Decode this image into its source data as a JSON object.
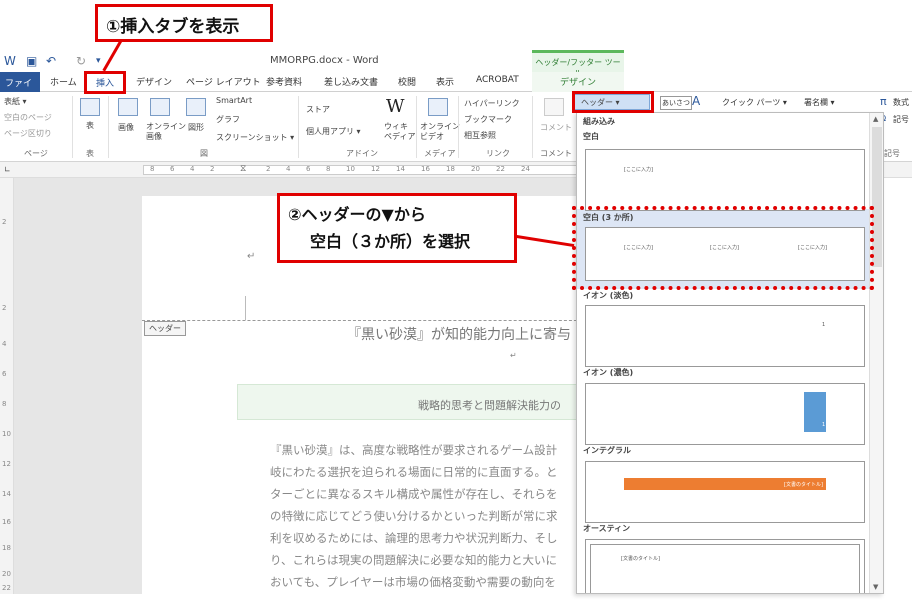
{
  "window": {
    "doc_title": "MMORPG.docx - Word",
    "context_group": "ヘッダー/フッター ツール",
    "context_tab": "デザイン"
  },
  "tabs": {
    "file": "ファイル",
    "home": "ホーム",
    "insert": "挿入",
    "design": "デザイン",
    "page_layout": "ページ レイアウト",
    "references": "参考資料",
    "mailings": "差し込み文書",
    "review": "校閲",
    "view": "表示",
    "acrobat": "ACROBAT"
  },
  "ribbon": {
    "pages": {
      "cover": "表紙 ▾",
      "blank": "空白のページ",
      "break": "ページ区切り",
      "label": "ページ"
    },
    "tables": {
      "table": "表",
      "label": "表"
    },
    "illustrations": {
      "picture": "画像",
      "online_picture": "オンライン\n画像",
      "shapes": "図形",
      "smartart": "SmartArt",
      "chart": "グラフ",
      "screenshot": "スクリーンショット ▾",
      "label": "図"
    },
    "addins": {
      "store": "ストア",
      "my_apps": "個人用アプリ ▾",
      "wikipedia": "ウィキ\nペディア",
      "label": "アドイン"
    },
    "media": {
      "online_video": "オンライン\nビデオ",
      "label": "メディア"
    },
    "links": {
      "hyperlink": "ハイパーリンク",
      "bookmark": "ブックマーク",
      "crossref": "相互参照",
      "label": "リンク"
    },
    "comments": {
      "comment": "コメント",
      "label": "コメント"
    },
    "header_button": "ヘッダー ▾",
    "quick_parts": "クイック パーツ ▾",
    "signature": "署名欄 ▾",
    "equation": "数式",
    "symbol": "記号",
    "symbols_label": "記号",
    "textbox_label": "あいさつ"
  },
  "ruler": [
    "8",
    "6",
    "4",
    "2",
    "2",
    "4",
    "6",
    "8",
    "10",
    "12",
    "14",
    "16",
    "18",
    "20",
    "22",
    "24"
  ],
  "vruler": [
    "2",
    "2",
    "4",
    "6",
    "8",
    "10",
    "12",
    "14",
    "16",
    "18",
    "20",
    "22"
  ],
  "document": {
    "header_tag": "ヘッダー",
    "heading": "『黒い砂漠』が知的能力向上に寄与",
    "subtitle": "戦略的思考と問題解決能力の",
    "body": [
      "『黒い砂漠』は、高度な戦略性が要求されるゲーム設計",
      "岐にわたる選択を迫られる場面に日常的に直面する。と",
      "ターごとに異なるスキル構成や属性が存在し、それらを",
      "の特徴に応じてどう使い分けるかといった判断が常に求",
      "利を収めるためには、論理的思考力や状況判断力、そし",
      "り、これらは現実の問題解決に必要な知的能力と大いに",
      "おいても、プレイヤーは市場の価格変動や需要の動向を"
    ]
  },
  "gallery": {
    "category": "組み込み",
    "items": [
      {
        "name": "空白",
        "placeholder": "[ここに入力]"
      },
      {
        "name": "空白 (3 か所)",
        "placeholder": "[ここに入力]"
      },
      {
        "name": "イオン (淡色)",
        "placeholder": "1"
      },
      {
        "name": "イオン (濃色)",
        "placeholder": "1"
      },
      {
        "name": "インテグラル",
        "placeholder": "[文書のタイトル]"
      },
      {
        "name": "オースティン",
        "placeholder": "[文書のタイトル]"
      }
    ]
  },
  "annotations": {
    "step1": "①挿入タブを表示",
    "step2_line1": "②ヘッダーの▼から",
    "step2_line2": "空白（３か所）を選択"
  },
  "colors": {
    "word_blue": "#2b579a",
    "accent_red": "#e00000",
    "context_green": "#5cb85c",
    "integral_orange": "#ed7d31",
    "ion_blue": "#5b9bd5"
  }
}
